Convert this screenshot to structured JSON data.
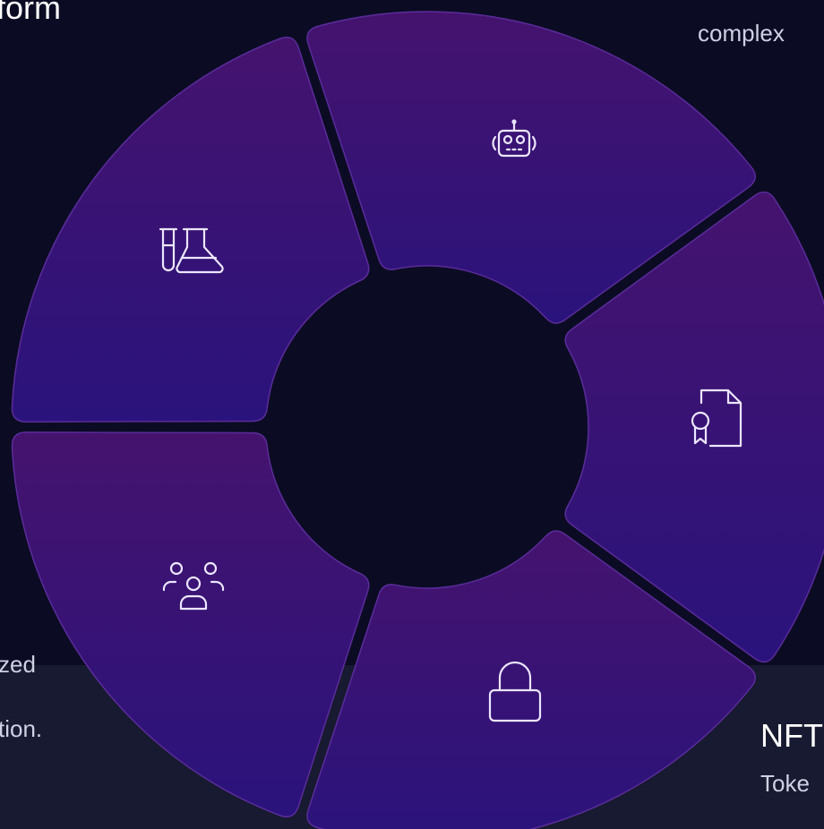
{
  "background": {
    "page": "#0b0c24",
    "band": "#171a30"
  },
  "accent": {
    "segment_start": "#45136e",
    "segment_end": "#2a137c",
    "segment_border": "#5a2c9a",
    "icon": "#ece6ff"
  },
  "texts": {
    "top_left": "form",
    "top_right": "complex",
    "left_line1": "zed",
    "left_line2": "tion.",
    "right_title": "NFT",
    "right_sub": "Toke"
  },
  "segments": [
    {
      "name": "robot",
      "icon": "robot-icon"
    },
    {
      "name": "certificate",
      "icon": "certificate-file-icon"
    },
    {
      "name": "lock",
      "icon": "lock-icon"
    },
    {
      "name": "users",
      "icon": "users-group-icon"
    },
    {
      "name": "lab",
      "icon": "flask-icon"
    }
  ]
}
